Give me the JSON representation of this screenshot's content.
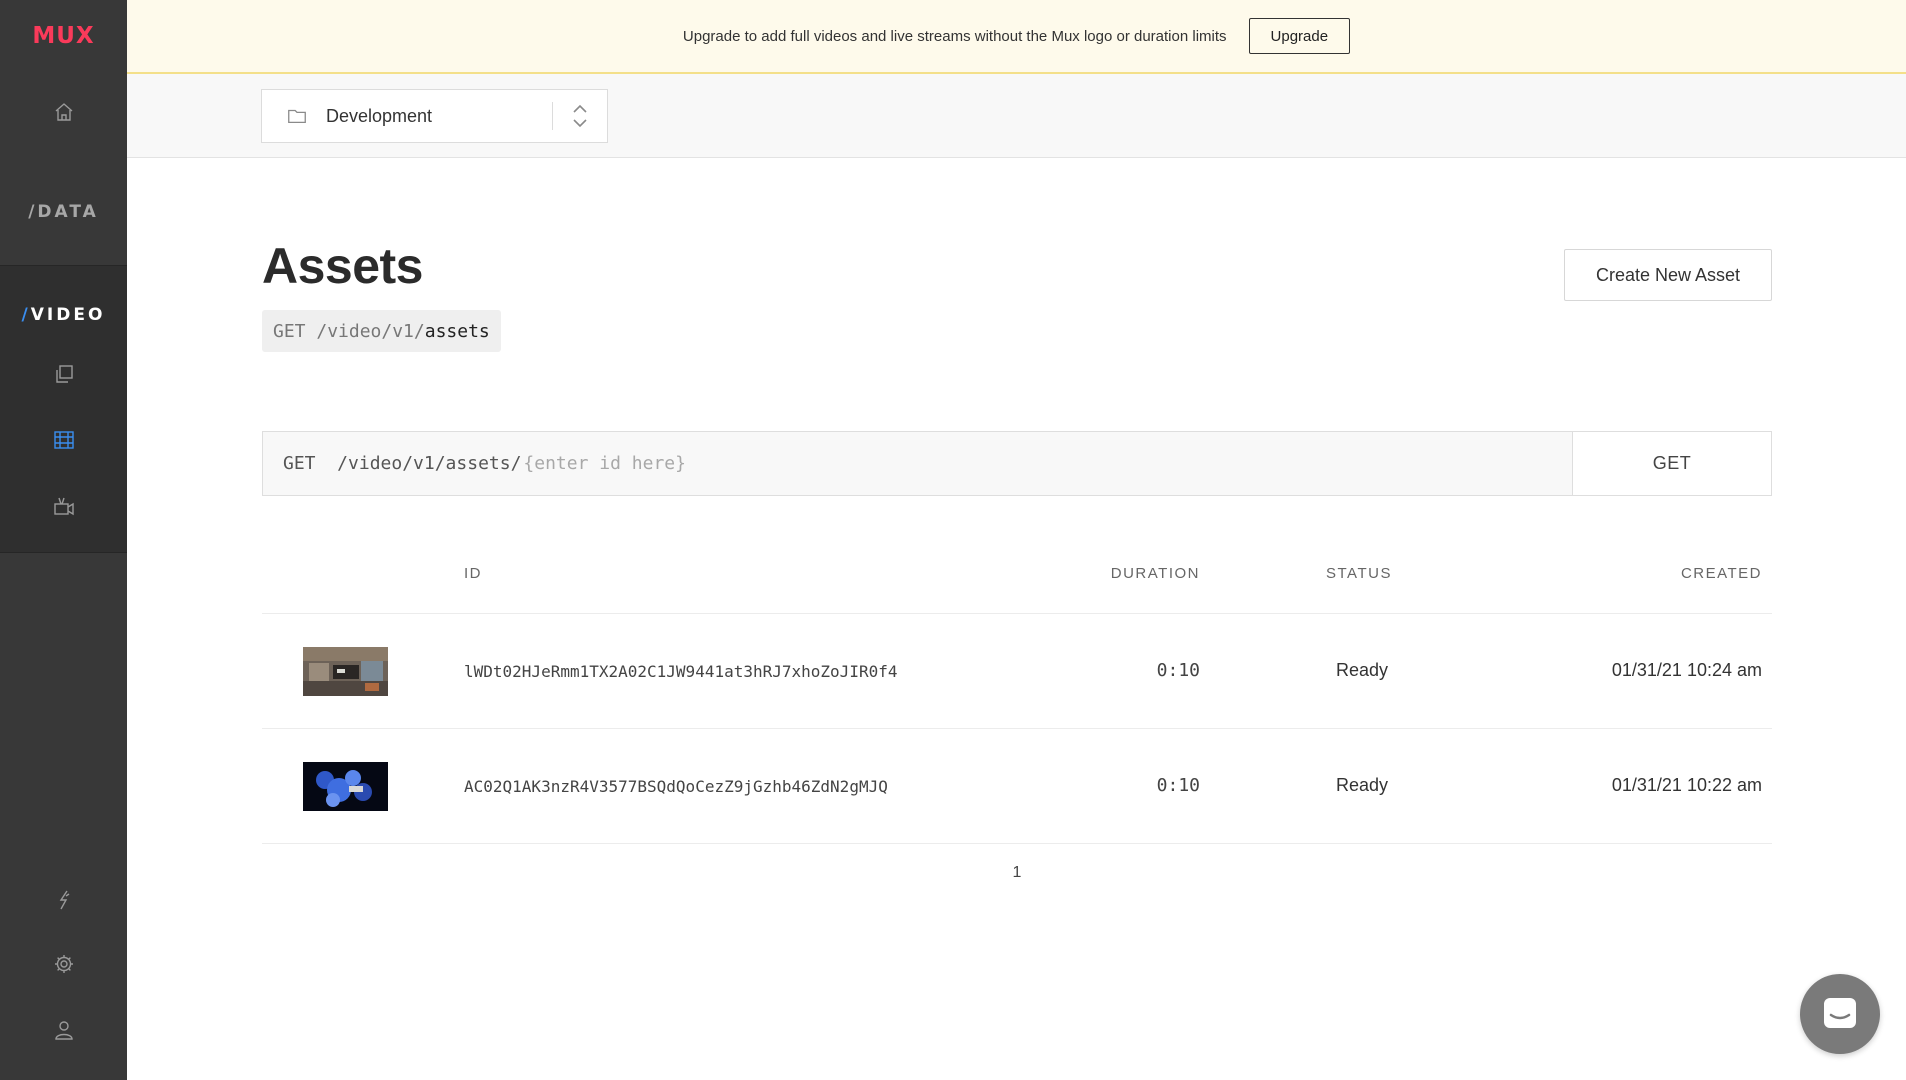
{
  "sidebar": {
    "brand": "MUX",
    "data_label": "/DATA",
    "video_slash": "/",
    "video_label": "VIDEO"
  },
  "banner": {
    "text": "Upgrade to add full videos and live streams without the Mux logo or duration limits",
    "button_label": "Upgrade"
  },
  "environment": {
    "name": "Development"
  },
  "page": {
    "title": "Assets",
    "endpoint_method": "GET",
    "endpoint_path": "/video/v1/",
    "endpoint_resource": "assets",
    "create_button_label": "Create New Asset"
  },
  "lookup": {
    "prefix": "GET  /video/v1/assets/",
    "placeholder": "{enter id here}",
    "button_label": "GET"
  },
  "table": {
    "columns": [
      "ID",
      "DURATION",
      "STATUS",
      "CREATED"
    ],
    "rows": [
      {
        "id": "lWDt02HJeRmm1TX2A02C1JW9441at3hRJ7xhoZoJIR0f4",
        "duration": "0:10",
        "status": "Ready",
        "created": "01/31/21 10:24 am"
      },
      {
        "id": "AC02Q1AK3nzR4V3577BSQdQoCezZ9jGzhb46ZdN2gMJQ",
        "duration": "0:10",
        "status": "Ready",
        "created": "01/31/21 10:22 am"
      }
    ],
    "page": "1"
  },
  "colors": {
    "brand": "#fa3a5a",
    "accent": "#3a8ef0",
    "sidebar": "#383838",
    "banner": "#fefaeb"
  }
}
